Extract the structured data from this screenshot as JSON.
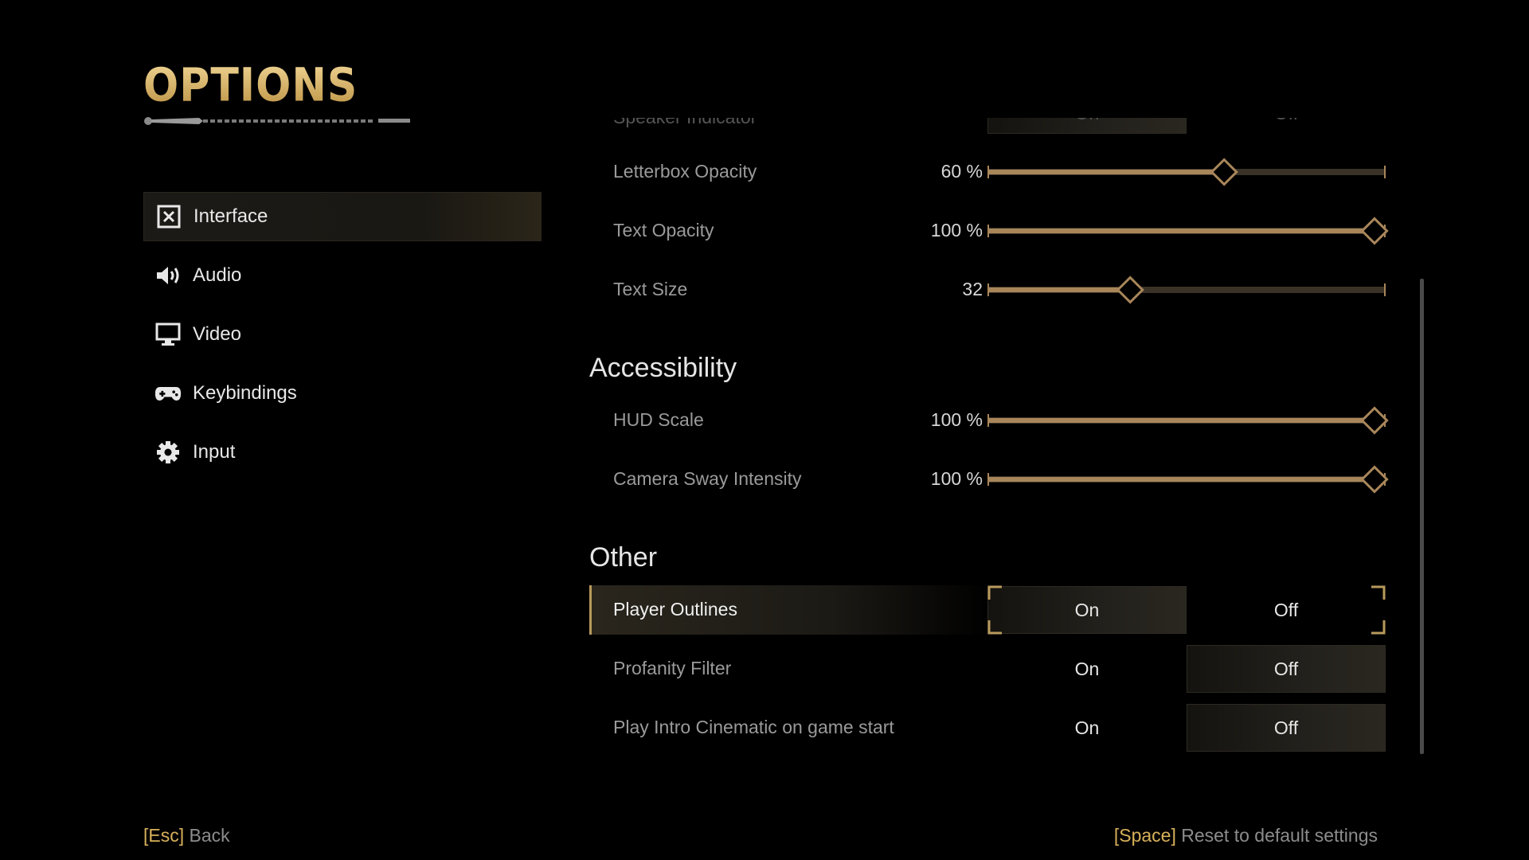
{
  "title": "OPTIONS",
  "nav": [
    {
      "label": "Interface",
      "icon": "interface-icon",
      "active": true
    },
    {
      "label": "Audio",
      "icon": "speaker-icon",
      "active": false
    },
    {
      "label": "Video",
      "icon": "monitor-icon",
      "active": false
    },
    {
      "label": "Keybindings",
      "icon": "gamepad-icon",
      "active": false
    },
    {
      "label": "Input",
      "icon": "gear-icon",
      "active": false
    }
  ],
  "cut_row": {
    "label": "Speaker Indicator",
    "on": "On",
    "off": "Off"
  },
  "sliders_top": [
    {
      "label": "Letterbox Opacity",
      "value_text": "60 %",
      "fraction": 0.6
    },
    {
      "label": "Text Opacity",
      "value_text": "100 %",
      "fraction": 1.0
    },
    {
      "label": "Text Size",
      "value_text": "32",
      "fraction": 0.35
    }
  ],
  "sections": {
    "accessibility": "Accessibility",
    "other": "Other"
  },
  "sliders_access": [
    {
      "label": "HUD Scale",
      "value_text": "100 %",
      "fraction": 1.0
    },
    {
      "label": "Camera Sway Intensity",
      "value_text": "100 %",
      "fraction": 1.0
    }
  ],
  "toggles": [
    {
      "label": "Player Outlines",
      "on": "On",
      "off": "Off",
      "selected": "on"
    },
    {
      "label": "Profanity Filter",
      "on": "On",
      "off": "Off",
      "selected": "off"
    },
    {
      "label": "Play Intro Cinematic on game start",
      "on": "On",
      "off": "Off",
      "selected": "off"
    }
  ],
  "footer": {
    "back_key": "[Esc]",
    "back_label": "Back",
    "reset_key": "[Space]",
    "reset_label": "Reset to default settings"
  },
  "colors": {
    "accent": "#d8b15a",
    "slider_fill": "#a8865a",
    "slider_track": "#3a3226"
  }
}
